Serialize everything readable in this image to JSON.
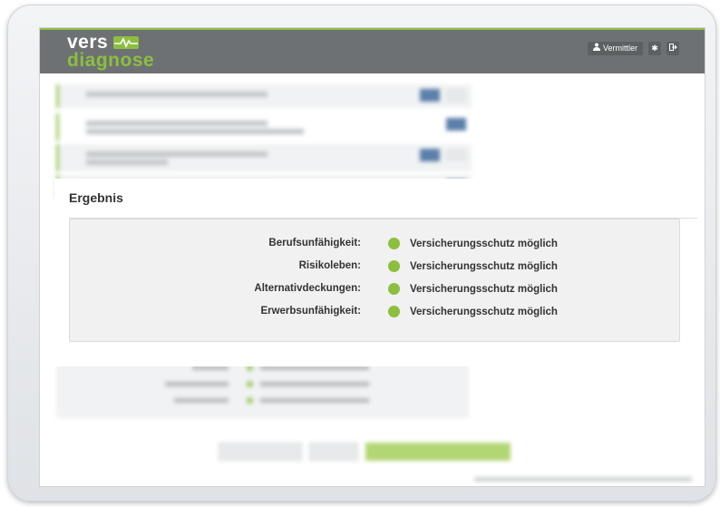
{
  "app": {
    "logo_line1": "vers",
    "logo_line2": "diagnose"
  },
  "nav": {
    "user_label": "Vermittler",
    "settings_icon": "gear-icon",
    "logout_icon": "logout-icon",
    "user_icon": "user-icon"
  },
  "modal": {
    "title": "Ergebnis",
    "results": [
      {
        "label": "Berufsunfähigkeit:",
        "value": "Versicherungsschutz möglich",
        "status_color": "#8cbf3f"
      },
      {
        "label": "Risikoleben:",
        "value": "Versicherungsschutz möglich",
        "status_color": "#8cbf3f"
      },
      {
        "label": "Alternativdeckungen:",
        "value": "Versicherungsschutz möglich",
        "status_color": "#8cbf3f"
      },
      {
        "label": "Erwerbsunfähigkeit:",
        "value": "Versicherungsschutz möglich",
        "status_color": "#8cbf3f"
      }
    ]
  },
  "colors": {
    "accent": "#8cbf3f",
    "header": "#6d7173",
    "primary_button": "#3f6a9c"
  }
}
